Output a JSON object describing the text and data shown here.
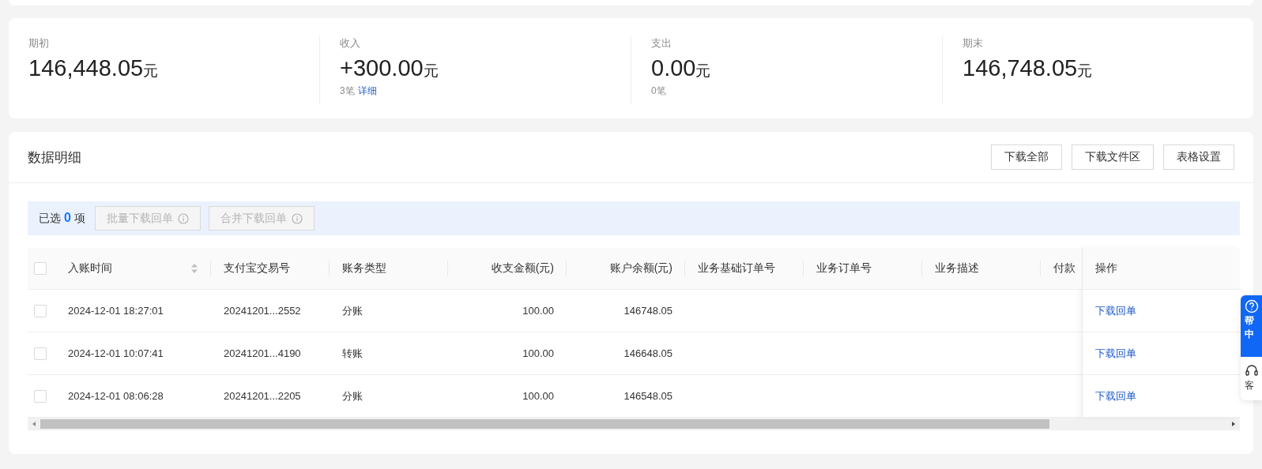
{
  "summary": [
    {
      "label": "期初",
      "amount": "146,448.05",
      "unit": "元"
    },
    {
      "label": "收入",
      "amount": "+300.00",
      "unit": "元",
      "count": "3笔",
      "link": "详细"
    },
    {
      "label": "支出",
      "amount": "0.00",
      "unit": "元",
      "count": "0笔"
    },
    {
      "label": "期末",
      "amount": "146,748.05",
      "unit": "元"
    }
  ],
  "details": {
    "title": "数据明细",
    "buttons": [
      "下载全部",
      "下载文件区",
      "表格设置"
    ],
    "selection": {
      "prefix": "已选",
      "count": "0",
      "suffix": "项",
      "buttons": [
        {
          "label": "批量下载回单",
          "disabled": true
        },
        {
          "label": "合并下载回单",
          "disabled": true
        }
      ]
    },
    "table": {
      "all_checked": false,
      "columns": [
        {
          "label": "入账时间",
          "sortable": true,
          "numeric": false
        },
        {
          "label": "支付宝交易号",
          "sortable": false,
          "numeric": false
        },
        {
          "label": "账务类型",
          "sortable": false,
          "numeric": false
        },
        {
          "label": "收支金额(元)",
          "sortable": false,
          "numeric": true
        },
        {
          "label": "账户余额(元)",
          "sortable": false,
          "numeric": true
        },
        {
          "label": "业务基础订单号",
          "sortable": false,
          "numeric": false
        },
        {
          "label": "业务订单号",
          "sortable": false,
          "numeric": false
        },
        {
          "label": "业务描述",
          "sortable": false,
          "numeric": false
        },
        {
          "label": "付款",
          "sortable": false,
          "numeric": false
        }
      ],
      "action_column": "操作",
      "rows": [
        {
          "checked": false,
          "cells": [
            "2024-12-01 18:27:01",
            "20241201...2552",
            "分账",
            "100.00",
            "146748.05",
            "",
            "",
            "",
            ""
          ],
          "action": "下载回单"
        },
        {
          "checked": false,
          "cells": [
            "2024-12-01 10:07:41",
            "20241201...4190",
            "转账",
            "100.00",
            "146648.05",
            "",
            "",
            "",
            ""
          ],
          "action": "下载回单"
        },
        {
          "checked": false,
          "cells": [
            "2024-12-01 08:06:28",
            "20241201...2205",
            "分账",
            "100.00",
            "146548.05",
            "",
            "",
            "",
            ""
          ],
          "action": "下载回单"
        }
      ]
    }
  },
  "help_widget": {
    "help_label": "帮",
    "help_label_2": "中",
    "service_label": "客"
  }
}
